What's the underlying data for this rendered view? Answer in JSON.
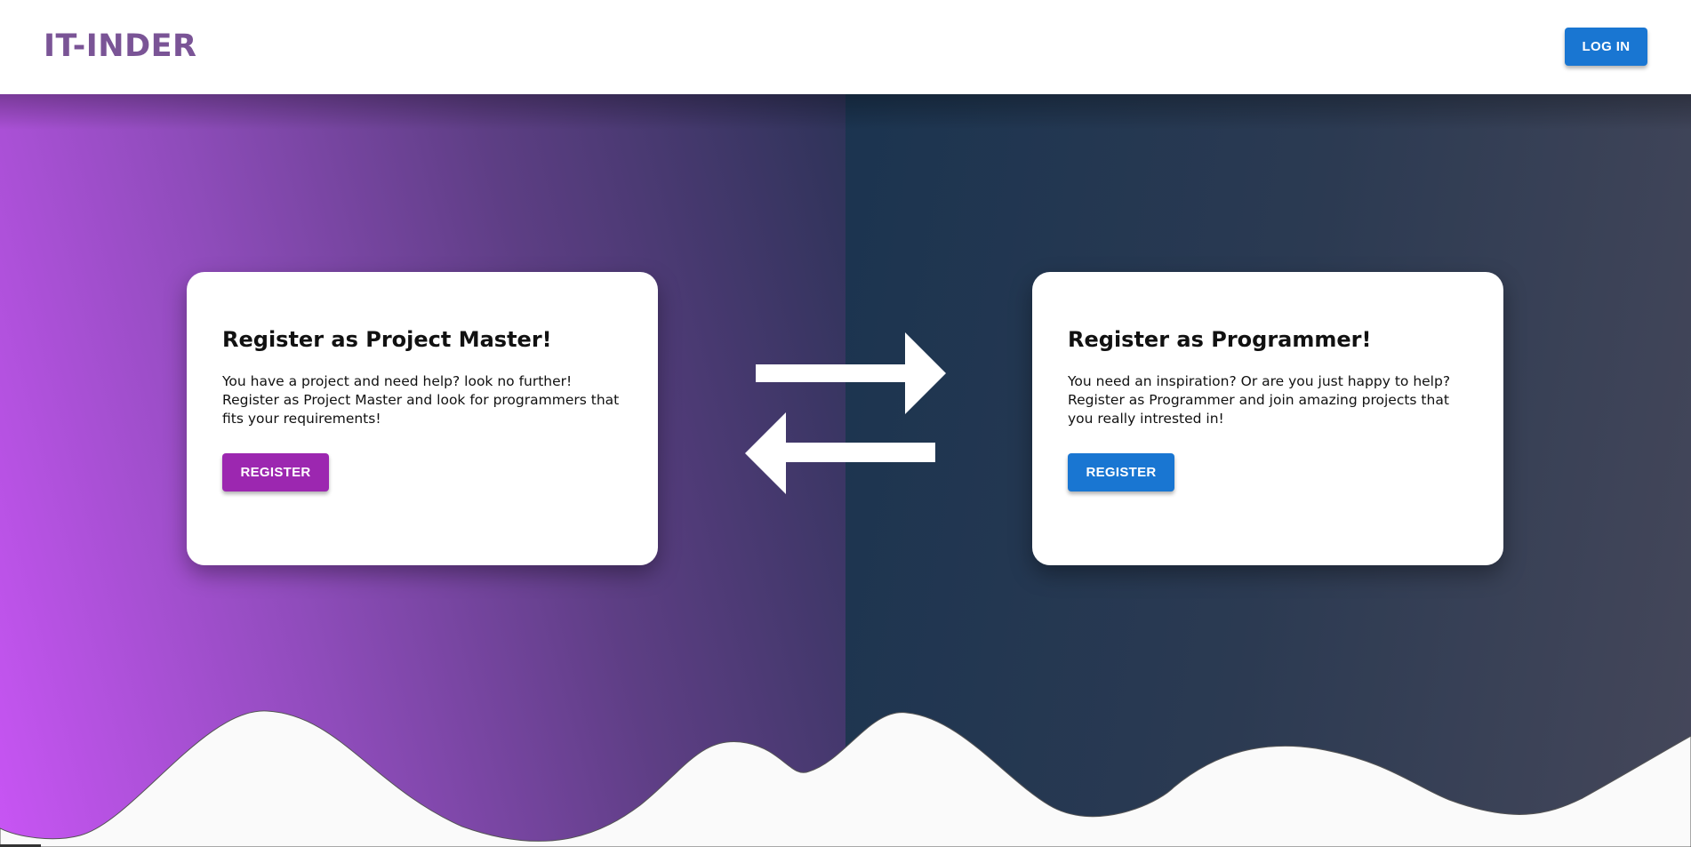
{
  "header": {
    "logo": "IT-INDER",
    "login_label": "LOG IN"
  },
  "colors": {
    "logo": "#7a5496",
    "primary_blue": "#1976d2",
    "primary_purple": "#9c27b0",
    "hero_left_start": "#c855f4",
    "hero_right_start": "#1b3450"
  },
  "cards": [
    {
      "title": "Register as Project Master!",
      "text": "You have a project and need help? look no further! Register as Project Master and look for programmers that fits your requirements!",
      "button_label": "REGISTER"
    },
    {
      "title": "Register as Programmer!",
      "text": "You need an inspiration? Or are you just happy to help? Register as Programmer and join amazing projects that you really intrested in!",
      "button_label": "REGISTER"
    }
  ],
  "icons": {
    "swap": "swap-arrows-icon"
  }
}
